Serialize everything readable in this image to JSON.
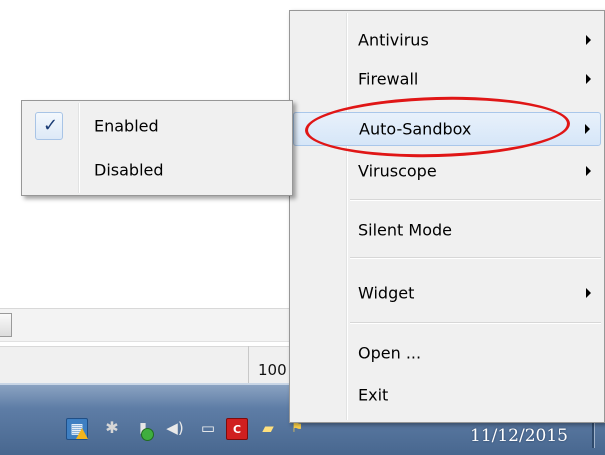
{
  "context_menu": {
    "items": [
      {
        "label": "Antivirus",
        "submenu": true
      },
      {
        "label": "Firewall",
        "submenu": true
      },
      {
        "label": "Auto-Sandbox",
        "submenu": true,
        "highlighted": true
      },
      {
        "label": "Viruscope",
        "submenu": true
      },
      {
        "label": "Silent Mode",
        "submenu": false
      },
      {
        "label": "Widget",
        "submenu": true
      },
      {
        "label": "Open ...",
        "submenu": false
      },
      {
        "label": "Exit",
        "submenu": false
      }
    ]
  },
  "submenu": {
    "items": [
      {
        "label": "Enabled",
        "checked": true
      },
      {
        "label": "Disabled",
        "checked": false
      }
    ],
    "check_glyph": "✓"
  },
  "background_window": {
    "zoom_text": "100"
  },
  "taskbar": {
    "date": "11/12/2015",
    "tray_icons": [
      "network-warning-icon",
      "virtualbox-icon",
      "usb-safely-remove-icon",
      "volume-icon",
      "monitor-icon",
      "comodo-icon",
      "folder-icon",
      "action-center-flag-icon"
    ]
  },
  "colors": {
    "highlight_ellipse": "#e01616",
    "menu_background": "#f0f0f0",
    "hover_background": "#d6e6f8",
    "taskbar": "#48678f"
  }
}
